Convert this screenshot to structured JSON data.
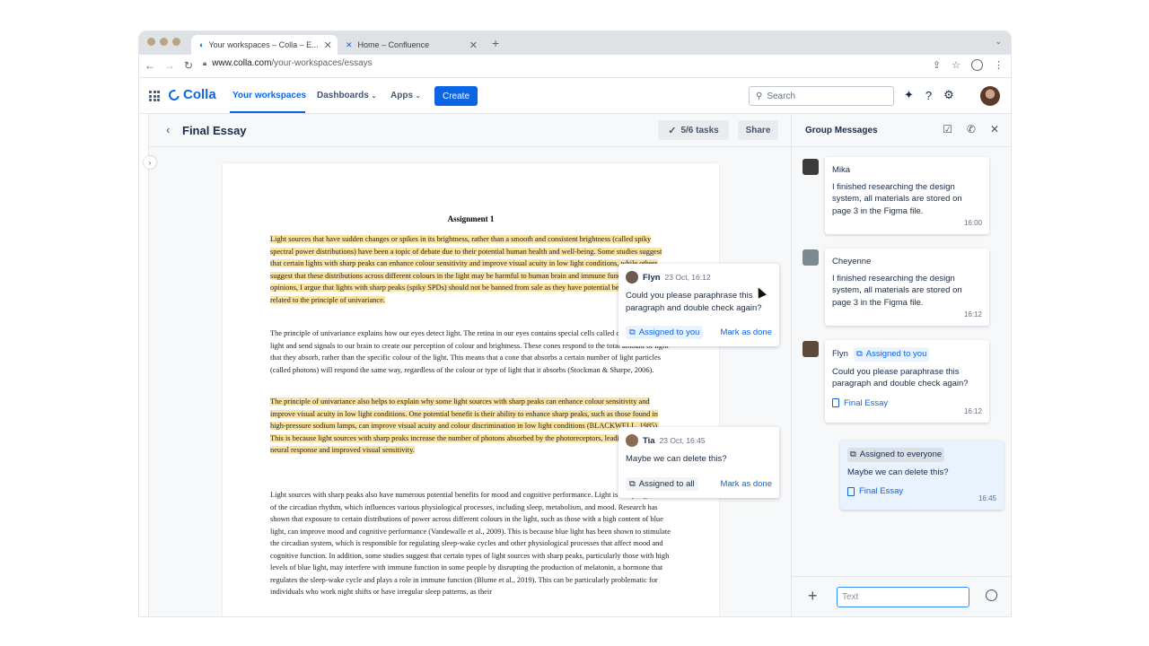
{
  "browser": {
    "tabs": [
      {
        "label": "Your workspaces – Colla – E...",
        "active": true
      },
      {
        "label": "Home – Confluence",
        "active": false
      }
    ],
    "close_glyph": "✕",
    "new_tab_glyph": "+",
    "menu_glyph": "⌄",
    "url_host": "www.colla.com",
    "url_path": "/your-workspaces/essays"
  },
  "header": {
    "brand": "Colla",
    "nav": [
      "Your workspaces",
      "Dashboards",
      "Apps"
    ],
    "create_label": "Create",
    "search_placeholder": "Search"
  },
  "doc": {
    "title": "Final Essay",
    "tasks_label": "5/6 tasks",
    "share_label": "Share",
    "assignment_title": "Assignment 1",
    "para1": "Light sources that have sudden changes or spikes in its brightness, rather than a smooth and consistent brightness (called spiky spectral power distributions) have been a topic of debate due to their potential human health and well-being. Some studies suggest that certain lights with sharp peaks can enhance colour sensitivity and improve visual acuity in low light conditions, while others suggest that these distributions across different colours in the light may be harmful to human brain and immune function. Despite the opinions, I argue that lights with sharp peaks (spiky SPDs) should not be banned from sale as they have potential benefits, which are related to the principle of univariance.",
    "para2": "The principle of univariance explains how our eyes detect light. The retina in our eyes contains special cells called cones that detect light and send signals to our brain to create our perception of colour and brightness. These cones respond to the total amount of light that they absorb, rather than the specific colour of the light. This means that a cone that absorbs a certain number of light particles (called photons) will respond the same way, regardless of the colour or type of light that it absorbs (Stockman & Sharpe, 2006).",
    "para3": "The principle of univariance also helps to explain why some light sources with sharp peaks can enhance colour sensitivity and improve visual acuity in low light conditions. One potential benefit is their ability to enhance sharp peaks, such as those found in high-pressure sodium lamps, can improve visual acuity and colour discrimination in low light conditions (BLACKWELL, 1985). This is because light sources with sharp peaks increase the number of photons absorbed by the photoreceptors, leading to a greater neural response and improved visual sensitivity.",
    "para4": "Light sources with sharp peaks also have numerous potential benefits for mood and cognitive performance. Light is a key regulator of the circadian rhythm, which influences various physiological processes, including sleep, metabolism, and mood. Research has shown that exposure to certain distributions of power across different colours in the light, such as those with a high content of blue light, can improve mood and cognitive performance (Vandewalle et al., 2009). This is because blue light has been shown to stimulate the circadian system, which is responsible for regulating sleep-wake cycles and other physiological processes that affect mood and cognitive function. In addition, some studies suggest that certain types of light sources with sharp peaks, particularly those with high levels of blue light, may interfere with immune function in some people by disrupting the production of melatonin, a hormone that regulates the sleep-wake cycle and plays a role in immune function (Blume et al., 2019). This can be particularly problematic for individuals who work night shifts or have irregular sleep patterns, as their"
  },
  "comments": [
    {
      "name": "Flyn",
      "date": "23 Oct, 16:12",
      "body": "Could you please paraphrase this paragraph and double check again?",
      "assigned": "Assigned to you",
      "action": "Mark as done"
    },
    {
      "name": "Tia",
      "date": "23 Oct, 16:45",
      "body": "Maybe we can delete this?",
      "assigned": "Assigned to all",
      "action": "Mark as done"
    }
  ],
  "chat": {
    "title": "Group Messages",
    "messages": [
      {
        "name": "Mika",
        "text": "I finished researching the design system, all materials are stored on page 3 in the Figma file.",
        "time": "16:00"
      },
      {
        "name": "Cheyenne",
        "text": "I finished researching the design system, all materials are stored on page 3 in the Figma file.",
        "time": "16:12"
      },
      {
        "name": "Flyn",
        "tag": "Assigned to you",
        "text": "Could you please paraphrase this paragraph and double check again?",
        "link": "Final Essay",
        "time": "16:12"
      },
      {
        "tag": "Assigned to everyone",
        "text": "Maybe we can delete this?",
        "link": "Final Essay",
        "time": "16:45"
      }
    ],
    "input_placeholder": "Text"
  },
  "colors": {
    "accent": "#0c66e4",
    "highlight": "#fbe3a2"
  }
}
